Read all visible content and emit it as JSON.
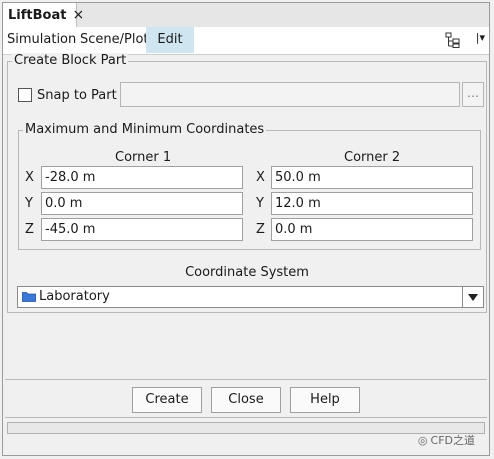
{
  "tab": {
    "title": "LiftBoat",
    "close": "×"
  },
  "menu": {
    "simulation": "Simulation",
    "scene_plot": "Scene/Plot",
    "edit": "Edit"
  },
  "create_block_part": {
    "legend": "Create Block Part",
    "snap_label": "Snap to Part",
    "snap_browse": "…",
    "coords_legend": "Maximum and Minimum Coordinates",
    "corner1_label": "Corner 1",
    "corner2_label": "Corner 2",
    "axes": [
      "X",
      "Y",
      "Z"
    ],
    "corner1": {
      "x": "-28.0 m",
      "y": "0.0 m",
      "z": "-45.0 m"
    },
    "corner2": {
      "x": "50.0 m",
      "y": "12.0 m",
      "z": "0.0 m"
    },
    "coordinate_system_label": "Coordinate System",
    "coordinate_system_value": "Laboratory"
  },
  "buttons": {
    "create": "Create",
    "close": "Close",
    "help": "Help"
  },
  "watermark": "CFD之道",
  "colors": {
    "active_menu": "#cfe6f0",
    "folder_icon": "#3c78d8"
  }
}
